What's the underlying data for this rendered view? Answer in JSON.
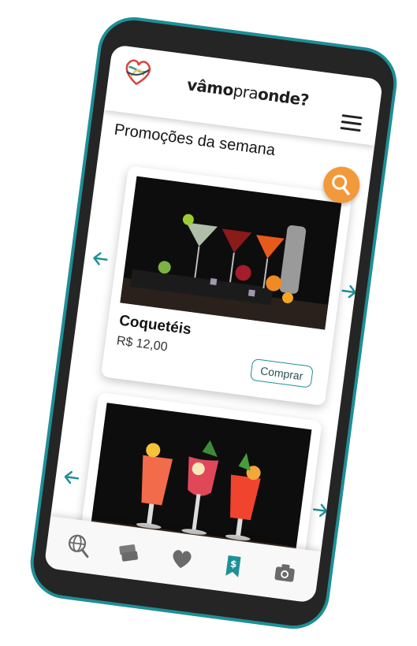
{
  "header": {
    "brand_part1": "vâmo",
    "brand_part2": "pra",
    "brand_part3": "onde?",
    "menu_icon": "hamburger-menu-icon",
    "logo_icon": "heart-logo-icon"
  },
  "section": {
    "title": "Promoções da semana"
  },
  "search": {
    "icon": "search-icon",
    "color": "#f2993a"
  },
  "products": [
    {
      "name": "Coquetéis",
      "price": "R$ 12,00",
      "button": "Comprar"
    }
  ],
  "nav": {
    "items": [
      {
        "icon": "globe-search-icon",
        "active": false
      },
      {
        "icon": "tickets-icon",
        "active": false
      },
      {
        "icon": "heart-icon",
        "active": false
      },
      {
        "icon": "promo-tag-icon",
        "active": true
      },
      {
        "icon": "camera-icon",
        "active": false
      }
    ]
  },
  "colors": {
    "accent": "#1f8f98",
    "orange": "#f2993a",
    "frame": "#252525"
  }
}
